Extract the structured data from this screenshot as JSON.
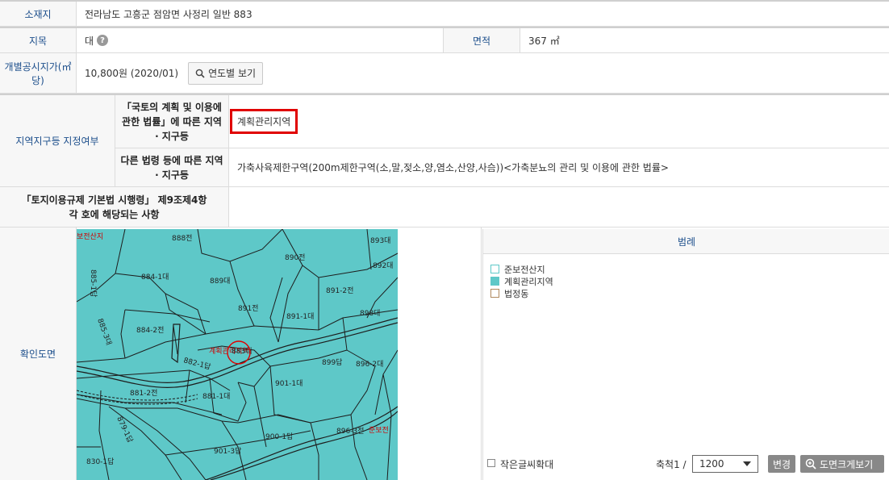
{
  "location": {
    "label": "소재지",
    "value": "전라남도 고흥군 점암면 사정리 일반 883"
  },
  "land": {
    "category_label": "지목",
    "category_value": "대",
    "help_glyph": "?",
    "area_label": "면적",
    "area_value": "367 ㎡"
  },
  "price": {
    "label": "개별공시지가(㎡당)",
    "value": "10,800원 (2020/01)",
    "button_label": "연도별 보기",
    "button_icon": "search-icon"
  },
  "zoning": {
    "group_label": "지역지구등 지정여부",
    "row1_label": "「국토의 계획 및 이용에 관한 법률」에 따른 지역 · 지구등",
    "row1_value": "계획관리지역",
    "row2_label": "다른 법령 등에 따른 지역 · 지구등",
    "row2_value": "가축사육제한구역(200m제한구역(소,말,젖소,양,염소,산양,사슴))<가축분뇨의 관리 및 이용에 관한 법률>"
  },
  "decree": {
    "label": "「토지이용규제 기본법 시행령」 제9조제4항 각 호에 해당되는 사항",
    "value": ""
  },
  "map": {
    "label": "확인도면",
    "parcels": [
      "888전",
      "893대",
      "890전",
      "892대",
      "884-1대",
      "889대",
      "891-2전",
      "885-1답",
      "891전",
      "891-1대",
      "898대",
      "884-2전",
      "885-3대",
      "계획관리지역",
      "883대",
      "882-1답",
      "899답",
      "896-2대",
      "881-2전",
      "881-1대",
      "901-1대",
      "879-1답",
      "900-1답",
      "896-3전",
      "901-3답",
      "830-1답",
      "보전산지",
      "준보전"
    ]
  },
  "legend": {
    "title": "범례",
    "items": [
      {
        "label": "준보전산지",
        "color": "#ffffff"
      },
      {
        "label": "계획관리지역",
        "color": "#5ec8c8"
      },
      {
        "label": "법정동",
        "color": "#ffffff"
      }
    ],
    "small_text_label": "작은글씨확대",
    "scale_label": "축척1 /",
    "scale_value": "1200",
    "change_button": "변경",
    "enlarge_button": "도면크게보기"
  },
  "colors": {
    "header_text": "#1d4f8c",
    "map_fill": "#5ec8c8",
    "highlight": "#e00000"
  }
}
